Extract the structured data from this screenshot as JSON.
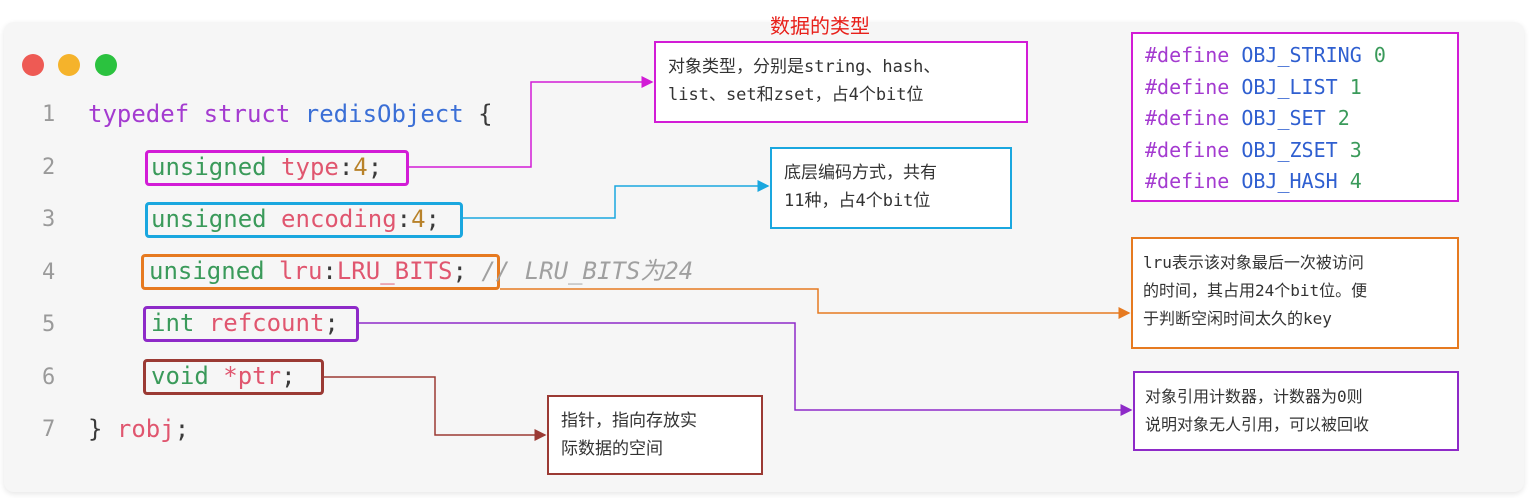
{
  "title": "数据的类型",
  "window_dots": {
    "red": "#ee5a54",
    "yellow": "#f5b32b",
    "green": "#2bc23f"
  },
  "code": {
    "line_numbers": [
      "1",
      "2",
      "3",
      "4",
      "5",
      "6",
      "7"
    ],
    "l1": {
      "kw": "typedef",
      "kw2": "struct",
      "name": "redisObject",
      "brace": "{"
    },
    "l2": {
      "kw": "unsigned",
      "field": "type",
      "colon": ":",
      "num": "4",
      "semi": ";"
    },
    "l3": {
      "kw": "unsigned",
      "field": "encoding",
      "colon": ":",
      "num": "4",
      "semi": ";"
    },
    "l4": {
      "kw": "unsigned",
      "field": "lru",
      "colon": ":",
      "val": "LRU_BITS",
      "semi": ";",
      "comment": "// LRU_BITS为24"
    },
    "l5": {
      "kw": "int",
      "field": "refcount",
      "semi": ";"
    },
    "l6": {
      "kw": "void",
      "star": "*",
      "field": "ptr",
      "semi": ";"
    },
    "l7": {
      "brace": "}",
      "name": "robj",
      "semi": ";"
    }
  },
  "notes": {
    "type_note": {
      "line1": "对象类型，分别是string、hash、",
      "line2": "list、set和zset，占4个bit位",
      "color": "#d21cd6"
    },
    "encoding_note": {
      "line1": "底层编码方式，共有",
      "line2": "11种，占4个bit位",
      "color": "#1aa7df"
    },
    "lru_note": {
      "line1": "lru表示该对象最后一次被访问",
      "line2": "的时间，其占用24个bit位。便",
      "line3": "于判断空闲时间太久的key",
      "color": "#e67a20"
    },
    "refcount_note": {
      "line1": "对象引用计数器，计数器为0则",
      "line2": "说明对象无人引用，可以被回收",
      "color": "#8e2ac8"
    },
    "ptr_note": {
      "line1": "指针，指向存放实",
      "line2": "际数据的空间",
      "color": "#9b3a34"
    }
  },
  "defines": [
    {
      "kw": "#define",
      "name": "OBJ_STRING",
      "value": "0"
    },
    {
      "kw": "#define",
      "name": "OBJ_LIST",
      "value": "1"
    },
    {
      "kw": "#define",
      "name": "OBJ_SET",
      "value": "2"
    },
    {
      "kw": "#define",
      "name": "OBJ_ZSET",
      "value": "3"
    },
    {
      "kw": "#define",
      "name": "OBJ_HASH",
      "value": "4"
    }
  ]
}
